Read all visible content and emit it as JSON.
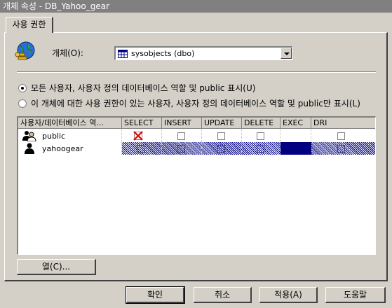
{
  "window": {
    "title": "개체 속성 - DB_Yahoo_gear"
  },
  "tabs": [
    {
      "label": "사용 권한"
    }
  ],
  "object": {
    "label": "개체(O):",
    "value": "sysobjects (dbo)"
  },
  "radios": [
    {
      "label": "모든 사용자, 사용자 정의 데이터베이스 역할 및 public 표시(U)",
      "checked": true
    },
    {
      "label": "이 개체에 대한 사용 권한이 있는 사용자, 사용자 정의 데이터베이스 역할 및 public만 표시(L)",
      "checked": false
    }
  ],
  "grid": {
    "columns": [
      "사용자/데이터베이스 역...",
      "SELECT",
      "INSERT",
      "UPDATE",
      "DELETE",
      "EXEC",
      "DRI"
    ],
    "rows": [
      {
        "name": "public",
        "icon": "group-users-icon",
        "select": "denied",
        "insert": "empty",
        "update": "empty",
        "delete": "empty",
        "exec": "none",
        "dri": "empty",
        "selected": false
      },
      {
        "name": "yahoogear",
        "icon": "user-icon",
        "select": "empty",
        "insert": "empty",
        "update": "empty",
        "delete": "empty",
        "exec": "none",
        "dri": "empty",
        "selected": true
      }
    ]
  },
  "buttons": {
    "columns": "열(C)...",
    "ok": "확인",
    "cancel": "취소",
    "apply": "적용(A)",
    "help": "도움말"
  },
  "colors": {
    "selection": "#000080",
    "title_bar": "#808080",
    "face": "#d4d0c8"
  }
}
